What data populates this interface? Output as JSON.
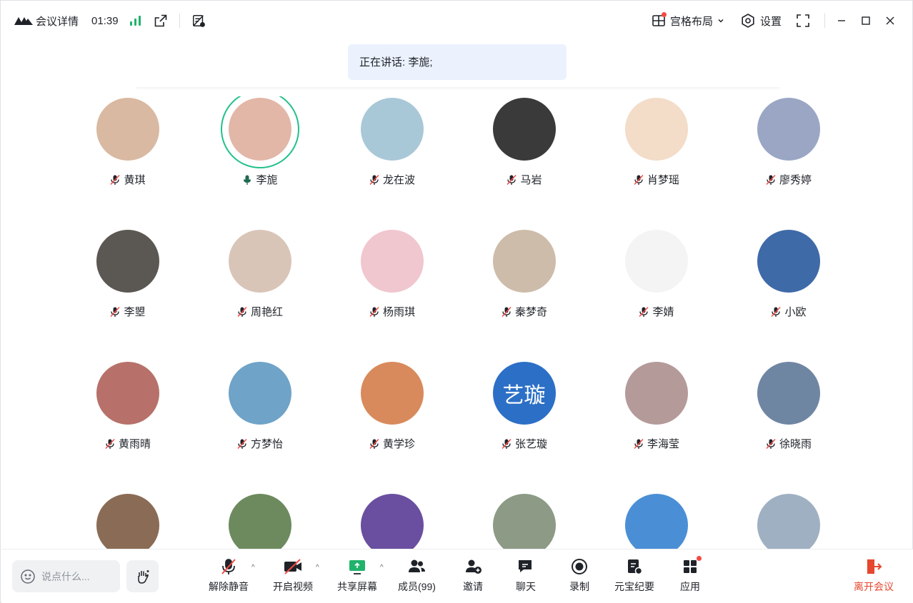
{
  "titlebar": {
    "meeting_info_label": "会议详情",
    "timer": "01:39",
    "layout_label": "宫格布局",
    "settings_label": "设置"
  },
  "speaking": {
    "text": "正在讲话: 李旎;"
  },
  "participants": [
    [
      {
        "name": "黄琪",
        "color": "#d9b9a2",
        "muted": true
      },
      {
        "name": "李旎",
        "color": "#e2b7a8",
        "muted": false,
        "speaking": true
      },
      {
        "name": "龙在波",
        "color": "#a9c8d7",
        "muted": true
      },
      {
        "name": "马岩",
        "color": "#3a3a3a",
        "muted": true
      },
      {
        "name": "肖梦瑶",
        "color": "#f3dcc8",
        "muted": true
      },
      {
        "name": "廖秀婷",
        "color": "#9aa6c4",
        "muted": true
      }
    ],
    [
      {
        "name": "李曌",
        "color": "#5b5752",
        "muted": true
      },
      {
        "name": "周艳红",
        "color": "#d9c5b8",
        "muted": true
      },
      {
        "name": "杨雨琪",
        "color": "#f0c6cf",
        "muted": true
      },
      {
        "name": "秦梦奇",
        "color": "#cdbcaa",
        "muted": true
      },
      {
        "name": "李婧",
        "color": "#f4f4f4",
        "muted": true
      },
      {
        "name": "小欧",
        "color": "#3f6aa8",
        "muted": true
      }
    ],
    [
      {
        "name": "黄雨晴",
        "color": "#b7716a",
        "muted": true
      },
      {
        "name": "方梦怡",
        "color": "#6fa3c8",
        "muted": true
      },
      {
        "name": "黄学珍",
        "color": "#d88a5c",
        "muted": true
      },
      {
        "name": "张艺璇",
        "color": "#2c6fc6",
        "muted": true,
        "initials": "艺璇"
      },
      {
        "name": "李海莹",
        "color": "#b59a9a",
        "muted": true
      },
      {
        "name": "徐晓雨",
        "color": "#6f86a3",
        "muted": true
      }
    ],
    [
      {
        "name": "",
        "color": "#8a6b55",
        "muted": true
      },
      {
        "name": "",
        "color": "#6d8a5e",
        "muted": true
      },
      {
        "name": "",
        "color": "#6a4fa0",
        "muted": true
      },
      {
        "name": "",
        "color": "#8c9a86",
        "muted": true
      },
      {
        "name": "",
        "color": "#4a8fd6",
        "muted": true
      },
      {
        "name": "",
        "color": "#9fb0c2",
        "muted": true
      }
    ]
  ],
  "toolbar": {
    "chat_placeholder": "说点什么...",
    "unmute": "解除静音",
    "start_video": "开启视频",
    "share_screen": "共享屏幕",
    "members": "成员(99)",
    "invite": "邀请",
    "chat": "聊天",
    "record": "录制",
    "summary": "元宝纪要",
    "apps": "应用",
    "leave": "离开会议"
  },
  "colors": {
    "accent_green": "#20b36b",
    "speaking_ring": "#22c08a",
    "banner_bg": "#ebf2fd",
    "leave_red": "#e5482f",
    "notify_red": "#f54a45"
  }
}
